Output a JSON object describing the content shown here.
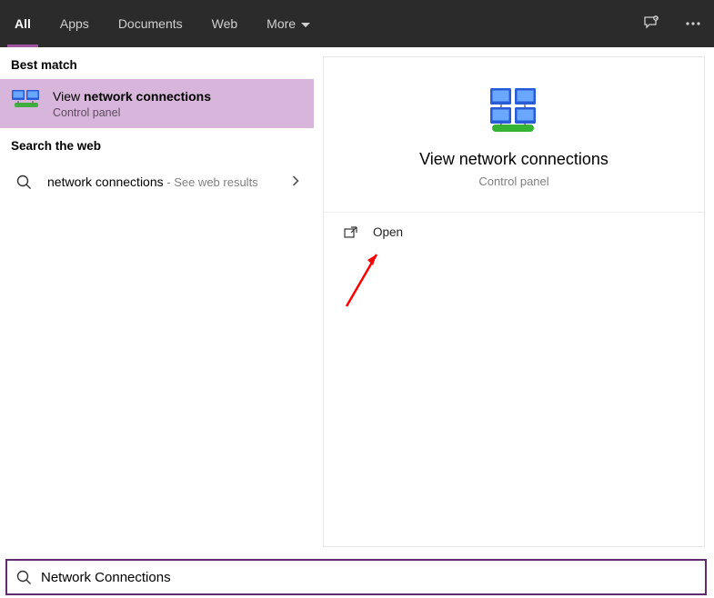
{
  "tabs": {
    "all": "All",
    "apps": "Apps",
    "documents": "Documents",
    "web": "Web",
    "more": "More"
  },
  "section_labels": {
    "best_match": "Best match",
    "search_web": "Search the web"
  },
  "best_match": {
    "title_prefix": "View ",
    "title_bold": "network connections",
    "subtitle": "Control panel"
  },
  "web_result": {
    "query": "network connections",
    "suffix": " - See web results"
  },
  "detail": {
    "title": "View network connections",
    "subtitle": "Control panel"
  },
  "actions": {
    "open": "Open"
  },
  "search": {
    "value": "Network Connections"
  }
}
